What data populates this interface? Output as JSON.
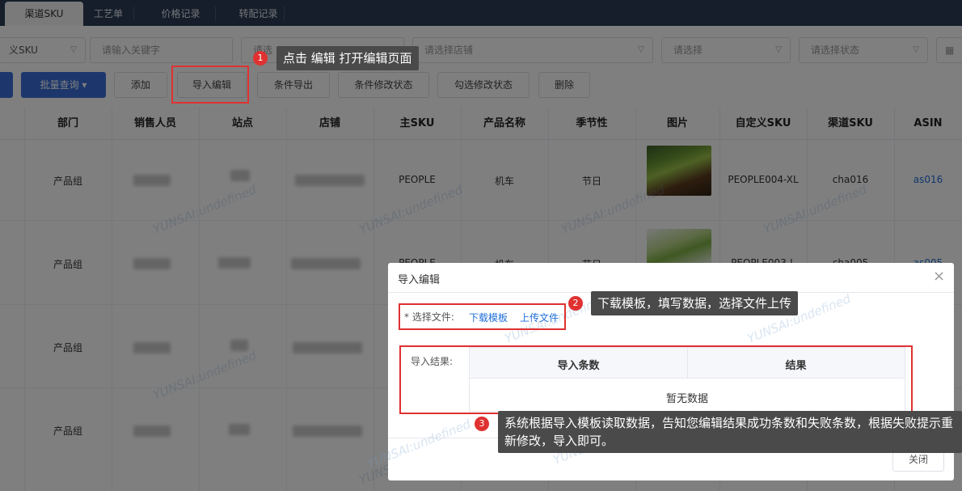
{
  "tabs": [
    {
      "label": "渠道SKU",
      "active": true
    },
    {
      "label": "工艺单",
      "active": false
    },
    {
      "label": "价格记录",
      "active": false
    },
    {
      "label": "转配记录",
      "active": false
    }
  ],
  "filters": {
    "sku_type": "义SKU",
    "keyword_placeholder": "请输入关键字",
    "third_placeholder": "请选",
    "shop_placeholder": "请选择店铺",
    "select_placeholder": "请选择",
    "status_placeholder": "请选择状态"
  },
  "toolbar": {
    "batch_query": "批量查询",
    "add": "添加",
    "import_edit": "导入编辑",
    "conditional_export": "条件导出",
    "conditional_modify_status": "条件修改状态",
    "checked_modify_status": "勾选修改状态",
    "delete": "删除"
  },
  "table": {
    "columns": [
      "部门",
      "销售人员",
      "站点",
      "店铺",
      "主SKU",
      "产品名称",
      "季节性",
      "图片",
      "自定义SKU",
      "渠道SKU",
      "ASIN"
    ],
    "rows": [
      {
        "dept": "产品组",
        "main_sku": "PEOPLE",
        "name": "机车",
        "season": "节日",
        "custom_sku": "PEOPLE004-XL",
        "channel_sku": "cha016",
        "asin": "as016"
      },
      {
        "dept": "产品组",
        "main_sku": "PEOPLE",
        "name": "机车",
        "season": "节日",
        "custom_sku": "PEOPLE003-L",
        "channel_sku": "cha005",
        "asin": "as005"
      },
      {
        "dept": "产品组"
      },
      {
        "dept": "产品组"
      }
    ]
  },
  "watermark": "YUNSAI:undefined",
  "modal": {
    "title": "导入编辑",
    "file_label": "* 选择文件:",
    "download_template": "下载模板",
    "upload_file": "上传文件",
    "result_label": "导入结果:",
    "col_count": "导入条数",
    "col_result": "结果",
    "empty": "暂无数据",
    "close_button": "关闭"
  },
  "callouts": [
    {
      "num": "1",
      "text": "点击 编辑 打开编辑页面"
    },
    {
      "num": "2",
      "text": "下载模板，填写数据，选择文件上传"
    },
    {
      "num": "3",
      "text": "系统根据导入模板读取数据，告知您编辑结果成功条数和失败条数，根据失败提示重新修改，导入即可。"
    }
  ],
  "colors": {
    "primary": "#3a6fd8",
    "highlight": "#e03131",
    "topbar": "#2b3c55",
    "link": "#1e6fd9"
  }
}
